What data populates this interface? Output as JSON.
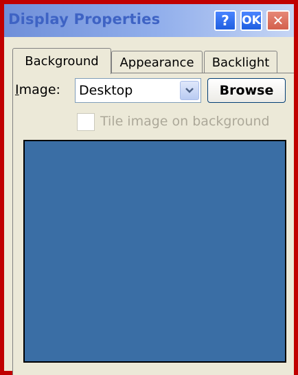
{
  "window": {
    "title": "Display Properties",
    "buttons": {
      "help": "?",
      "ok": "OK",
      "close": "✕"
    }
  },
  "tabs": [
    {
      "label": "Background",
      "active": true
    },
    {
      "label": "Appearance",
      "active": false
    },
    {
      "label": "Backlight",
      "active": false
    }
  ],
  "background_tab": {
    "image_label_prefix": "I",
    "image_label_rest": "mage:",
    "image_value": "Desktop",
    "browse_label": "Browse",
    "tile_label": "Tile image on background",
    "tile_checked": false,
    "tile_enabled": false
  },
  "colors": {
    "frame": "#c00000",
    "preview": "#3a6ea5",
    "dialog": "#ece9d8"
  }
}
